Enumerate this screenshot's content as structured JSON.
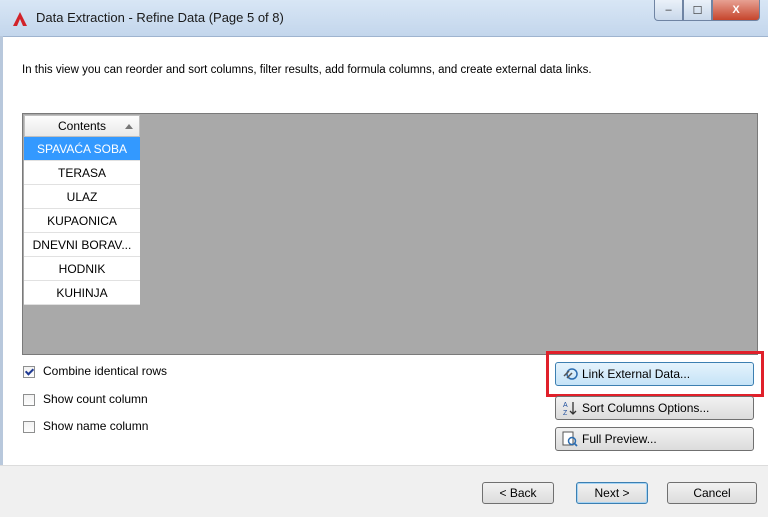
{
  "window": {
    "title": "Data Extraction - Refine Data (Page 5 of 8)",
    "minimize": "–",
    "maximize": "☐",
    "close": "X"
  },
  "description": "In this view you can reorder and sort columns, filter results, add formula columns, and create external data links.",
  "grid": {
    "column_header": "Contents",
    "rows": [
      "SPAVAĆA SOBA",
      "TERASA",
      "ULAZ",
      "KUPAONICA",
      "DNEVNI BORAV...",
      "HODNIK",
      "KUHINJA"
    ],
    "selected_index": 0
  },
  "options": {
    "combine_identical_rows": {
      "label": "Combine identical rows",
      "checked": true
    },
    "show_count_column": {
      "label": "Show count column",
      "checked": false
    },
    "show_name_column": {
      "label": "Show name column",
      "checked": false
    }
  },
  "actions": {
    "link_external_data": "Link External Data...",
    "sort_columns_options": "Sort Columns Options...",
    "full_preview": "Full Preview..."
  },
  "footer": {
    "back": "< Back",
    "next": "Next >",
    "cancel": "Cancel"
  },
  "colors": {
    "selection": "#3399ff",
    "highlight_box": "#e0202a",
    "grid_background": "#a9a9a9"
  },
  "icons": [
    "autocad-logo-icon",
    "link-external-data-icon",
    "sort-az-icon",
    "full-preview-icon"
  ]
}
